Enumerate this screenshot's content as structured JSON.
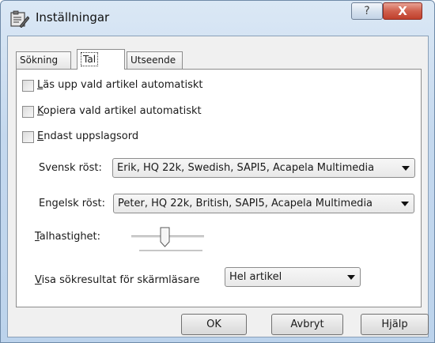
{
  "window": {
    "title": "Inställningar",
    "help_glyph": "?",
    "close_glyph": "X"
  },
  "tabs": [
    {
      "label": "Sökning",
      "active": false
    },
    {
      "label": "Tal",
      "active": true
    },
    {
      "label": "Utseende",
      "active": false
    }
  ],
  "options": {
    "read_aloud": {
      "prefix": "L",
      "rest": "äs upp vald artikel automatiskt",
      "checked": false
    },
    "copy_selected": {
      "prefix": "K",
      "rest": "opiera vald artikel automatiskt",
      "checked": false
    },
    "headwords_only": {
      "prefix": "E",
      "rest": "ndast uppslagsord",
      "checked": false
    }
  },
  "voices": {
    "swedish_label": "Svensk röst:",
    "swedish_value": "Erik, HQ 22k, Swedish, SAPI5, Acapela Multimedia",
    "english_label": "Engelsk röst:",
    "english_value": "Peter, HQ 22k, British, SAPI5, Acapela Multimedia"
  },
  "speech_rate": {
    "prefix": "T",
    "rest": "alhastighet:",
    "level": 0.45
  },
  "results": {
    "prefix": "V",
    "rest": "isa sökresultat för skärmläsare",
    "value": "Hel artikel"
  },
  "buttons": {
    "ok": "OK",
    "cancel": "Avbryt",
    "help": "Hjälp"
  },
  "icons": {
    "app": "settings-app-icon",
    "help": "question-mark-icon",
    "close": "close-x-icon",
    "dropdown": "chevron-down-icon"
  }
}
